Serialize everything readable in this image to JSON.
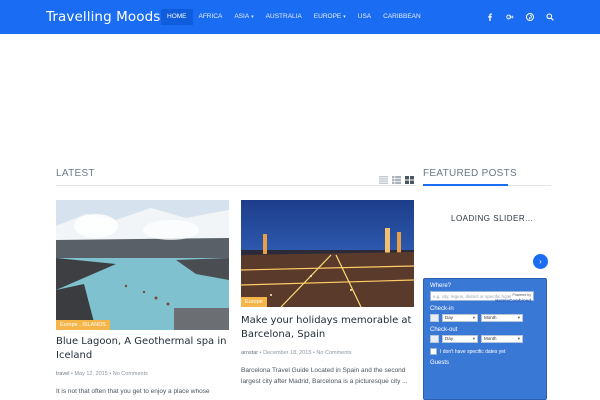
{
  "site": {
    "title": "Travelling Moods"
  },
  "nav": [
    {
      "label": "HOME",
      "active": true,
      "caret": ""
    },
    {
      "label": "AFRICA",
      "active": false,
      "caret": ""
    },
    {
      "label": "ASIA",
      "active": false,
      "caret": "▾"
    },
    {
      "label": "AUSTRALIA",
      "active": false,
      "caret": ""
    },
    {
      "label": "EUROPE",
      "active": false,
      "caret": "▾"
    },
    {
      "label": "USA",
      "active": false,
      "caret": ""
    },
    {
      "label": "CARIBBEAN",
      "active": false,
      "caret": ""
    }
  ],
  "social_icons": [
    "facebook-icon",
    "google-plus-icon",
    "pinterest-icon",
    "search-icon"
  ],
  "sections": {
    "latest": "LATEST",
    "featured": "FEATURED POSTS"
  },
  "posts": [
    {
      "tags": "Europe , ISLANDS",
      "title": "Blue Lagoon, A Geothermal spa in Iceland",
      "author": "travel",
      "date": "May 12, 2015",
      "comments": "No Comments",
      "excerpt": "It is not that often that you get to enjoy a place whose"
    },
    {
      "tags": "Europe",
      "title": "Make your holidays memorable at Barcelona, Spain",
      "author": "arnstar",
      "date": "December 18, 2015",
      "comments": "No Comments",
      "excerpt": "Barcelona Travel Guide Located in Spain and the second largest city after Madrid, Barcelona is a picturesque city ..."
    }
  ],
  "slider": {
    "loading": "LOADING SLIDER...",
    "next_glyph": "›"
  },
  "widget": {
    "where_label": "Where?",
    "where_placeholder": "e.g. city, region, district or specific hotel",
    "powered_by": "Powered by",
    "brand": "HotelsCombined",
    "checkin_label": "Check-in",
    "checkout_label": "Check-out",
    "day_label": "Day",
    "month_label": "Month",
    "no_dates_label": "I don't have specific dates yet",
    "guests_label": "Guests"
  },
  "colors": {
    "accent": "#1a6cf3",
    "tag": "#f5b548"
  }
}
